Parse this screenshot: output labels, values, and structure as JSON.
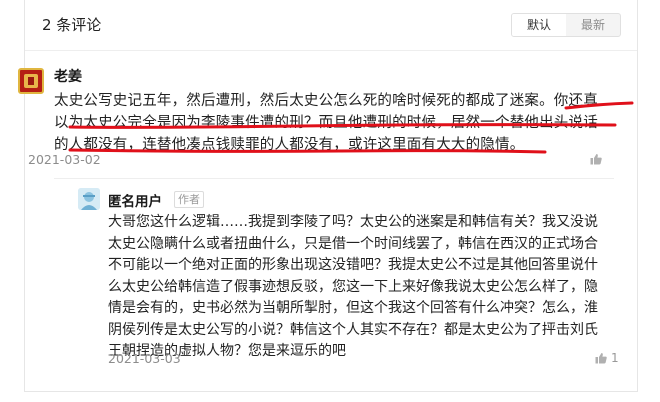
{
  "header": {
    "title": "2 条评论"
  },
  "sort": {
    "default_label": "默认",
    "latest_label": "最新"
  },
  "comment": {
    "author": "老姜",
    "lines": [
      "太史公写史记五年，然后遭刑，然后太史公怎么死的啥时候死的都成了迷案。你还真",
      "以为太史公完全是因为李陵事件遭的刑？而且他遭刑的时候，居然一个替他出头说话",
      "的人都没有，连替他凑点钱赎罪的人都没有，或许这里面有大大的隐情。"
    ],
    "date": "2021-03-02",
    "likes": ""
  },
  "reply": {
    "author": "匿名用户",
    "tag": "作者",
    "lines": [
      "大哥您这什么逻辑……我提到李陵了吗？太史公的迷案是和韩信有关？我又没说",
      "太史公隐瞒什么或者扭曲什么，只是借一个时间线罢了，韩信在西汉的正式场合",
      "不可能以一个绝对正面的形象出现这没错吧？我提太史公不过是其他回答里说什",
      "么太史公给韩信造了假事迹想反驳，您这一下上来好像我说太史公怎么样了，隐",
      "情是会有的，史书必然为当朝所掣肘，但这个我这个回答有什么冲突？怎么，淮",
      "阴侯列传是太史公写的小说？韩信这个人其实不存在？都是太史公为了抨击刘氏",
      "王朝捏造的虚拟人物？您是来逗乐的吧"
    ],
    "date": "2021-03-03",
    "likes": "1"
  },
  "colors": {
    "annotation_red": "#e0101a",
    "muted": "#8c8c8c",
    "text": "#222222"
  }
}
